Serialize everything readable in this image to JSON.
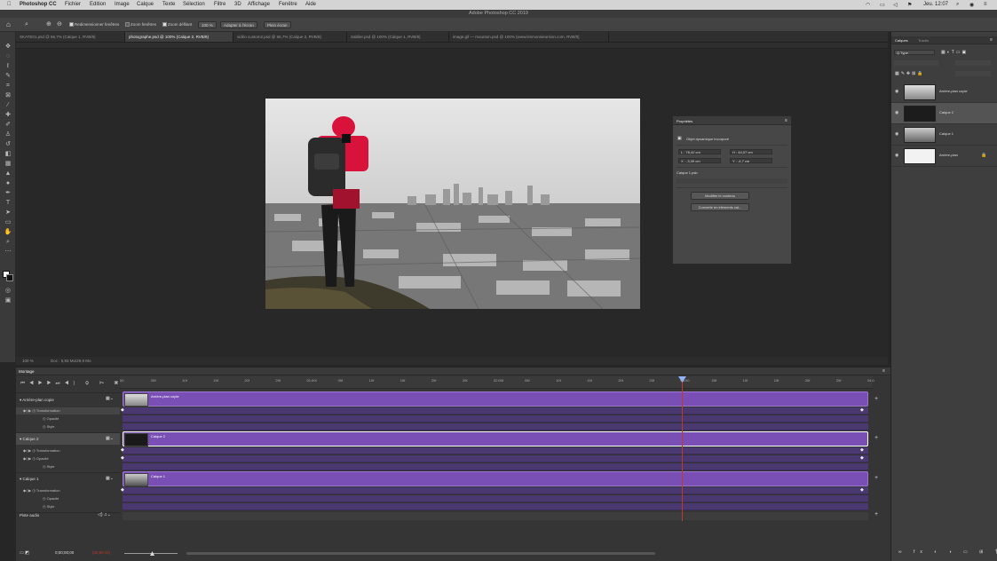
{
  "menubar": {
    "app": "Photoshop CC",
    "items": [
      "Fichier",
      "Edition",
      "Image",
      "Calque",
      "Texte",
      "Sélection",
      "Filtre",
      "3D",
      "Affichage",
      "Fenêtre",
      "Aide"
    ],
    "clock": "Jeu. 12:07"
  },
  "window_title": "Adobe Photoshop CC 2019",
  "options": {
    "resize_windows": "Redimensionner fenêtres",
    "zoom_all": "Zoom fenêtres",
    "scrubby_zoom": "Zoom défilant",
    "zoom_value": "100 %",
    "fit_screen": "Adapter à l'écran",
    "fill_screen": "Plein écran"
  },
  "tabs": [
    "SKATE01.psd @ 66,7% (Calque 1, RVB/8)",
    "photographe.psd @ 100% (Calque 2, RVB/8)",
    "vidéo custom2.psd @ 66,7% (Calque 2, RVB/8)",
    "Sablier.psd @ 100% (Calque 1, RVB/8)",
    "image.gif — mounton.psd @ 100% (www.lesmonsieursion.com, RVB/8)"
  ],
  "status": {
    "zoom": "100 %",
    "doc": "Doc : 5,93 Mo/29,9 Mo"
  },
  "properties": {
    "title": "Propriétés",
    "object_type": "Objet dynamique incorporé",
    "w": "L : 78,42 cm",
    "h": "H : 44,07 cm",
    "x": "X : -3,39 cm",
    "y": "Y : -4,7 cm",
    "layer_name": "Calque 1.psb",
    "edit_contents": "Modifier le contenu",
    "convert_layers": "Convertir en éléments cal..."
  },
  "layers_panel": {
    "tab_layers": "Calques",
    "tab_paths": "Tracés",
    "filter": "Q Type",
    "layers": [
      {
        "name": "Arrière-plan copie",
        "selected": false
      },
      {
        "name": "Calque 2",
        "selected": true
      },
      {
        "name": "Calque 1",
        "selected": false
      },
      {
        "name": "Arrière-plan",
        "selected": false
      }
    ]
  },
  "timeline": {
    "title": "Montage",
    "ruler_ticks": [
      "00",
      "05f",
      "10f",
      "15f",
      "20f",
      "25f",
      "01:00f",
      "05f",
      "10f",
      "15f",
      "20f",
      "25f",
      "02:00f",
      "05f",
      "10f",
      "15f",
      "20f",
      "25f",
      "03:00",
      "05f",
      "10f",
      "15f",
      "20f",
      "25f",
      "04:0"
    ],
    "tracks": [
      {
        "name": "Arrière-plan copie",
        "clip": "Arrière-plan copie",
        "props": [
          "Transformation",
          "Opacité",
          "Style"
        ]
      },
      {
        "name": "Calque 2",
        "clip": "Calque 2",
        "props": [
          "Transformation",
          "Opacité",
          "Style"
        ]
      },
      {
        "name": "Calque 1",
        "clip": "Calque 1",
        "props": [
          "Transformation",
          "Opacité",
          "Style"
        ]
      }
    ],
    "audio_track": "Piste audio",
    "timecode": "0;00;00;00",
    "fps": "(30,00 i/s)"
  }
}
